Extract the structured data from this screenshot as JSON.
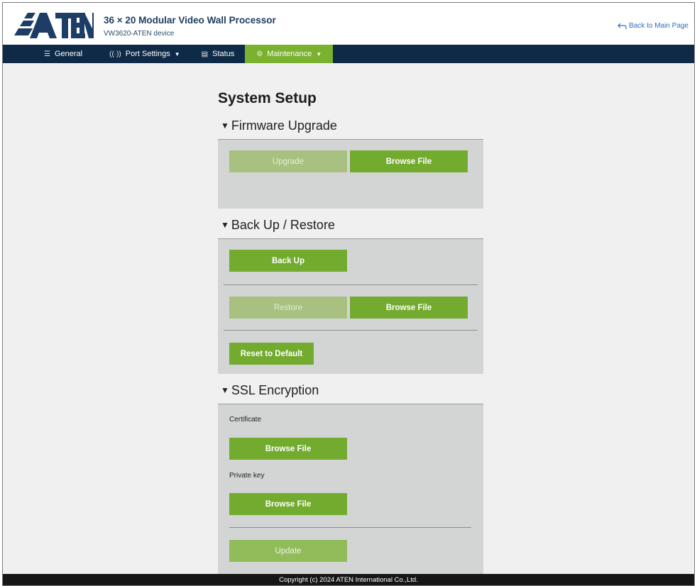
{
  "header": {
    "logo_text": "ATEN",
    "title": "36 × 20 Modular Video Wall Processor",
    "subtitle": "VW3620-ATEN device",
    "back_link": "Back to Main Page"
  },
  "nav": {
    "items": [
      {
        "label": "General",
        "icon": "list-icon"
      },
      {
        "label": "Port Settings",
        "icon": "port-icon"
      },
      {
        "label": "Status",
        "icon": "status-icon"
      },
      {
        "label": "Maintenance",
        "icon": "gear-icon"
      }
    ],
    "active": "Maintenance"
  },
  "page": {
    "title": "System Setup"
  },
  "firmware": {
    "heading": "Firmware Upgrade",
    "upgrade_label": "Upgrade",
    "browse_label": "Browse File"
  },
  "backup": {
    "heading": "Back Up / Restore",
    "backup_label": "Back Up",
    "restore_label": "Restore",
    "browse_label": "Browse File",
    "reset_label": "Reset to Default"
  },
  "ssl": {
    "heading": "SSL Encryption",
    "certificate_label": "Certificate",
    "cert_browse_label": "Browse File",
    "key_label": "Private key",
    "key_browse_label": "Browse File",
    "update_label": "Update"
  },
  "footer": {
    "copyright": "Copyright (c) 2024 ATEN International Co.,Ltd."
  },
  "colors": {
    "nav_bg": "#0e2a47",
    "accent": "#7ab22f",
    "button": "#73ab2e",
    "panel": "#d3d5d4",
    "title": "#1e3d63"
  }
}
